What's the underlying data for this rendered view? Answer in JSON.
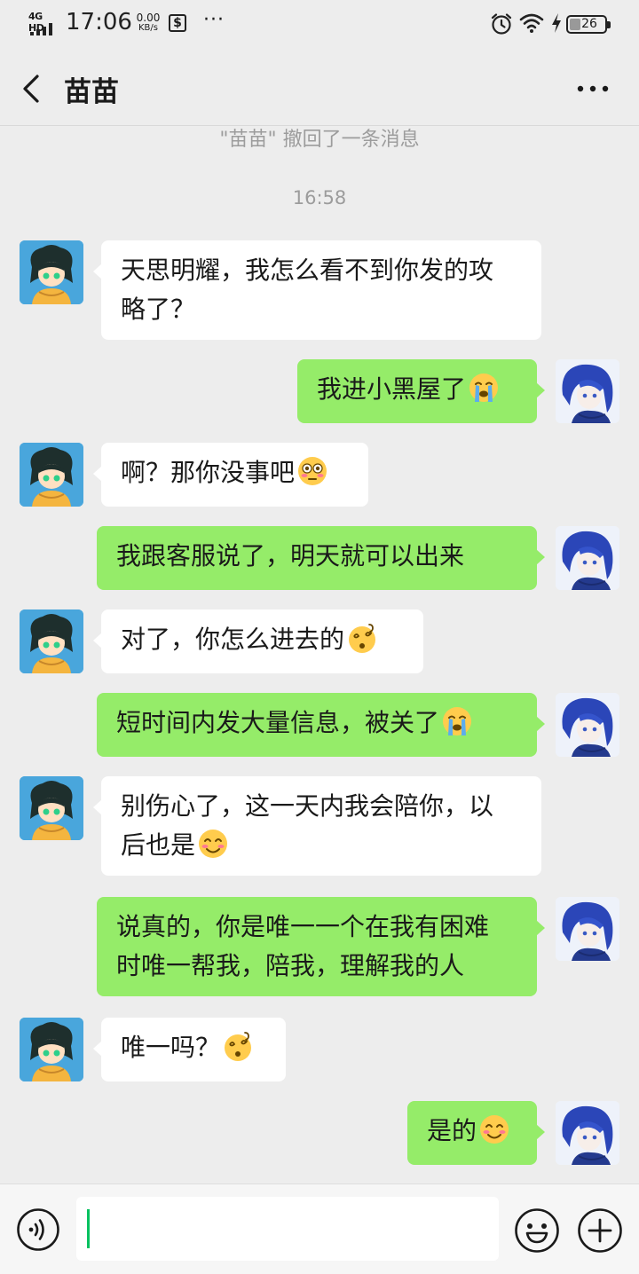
{
  "status_bar": {
    "network": "4G HD",
    "time": "17:06",
    "speed_value": "0.00",
    "speed_unit": "KB/s",
    "dollar_icon": "$",
    "more": "···",
    "battery": "26"
  },
  "header": {
    "title": "苗苗",
    "back_icon": "chevron-left-icon",
    "more_icon": "more-dots-icon"
  },
  "conversation": {
    "recall_notice": "\"苗苗\" 撤回了一条消息",
    "timestamp": "16:58",
    "messages": [
      {
        "side": "left",
        "text": "天思明耀，我怎么看不到你发的攻\n略了？",
        "emoji": ""
      },
      {
        "side": "right",
        "text": "我进小黑屋了",
        "emoji": "crying-face"
      },
      {
        "side": "left",
        "text": "啊？那你没事吧",
        "emoji": "flushed-face"
      },
      {
        "side": "right",
        "text": "我跟客服说了，明天就可以出来",
        "emoji": ""
      },
      {
        "side": "left",
        "text": "对了，你怎么进去的",
        "emoji": "dizzy-face"
      },
      {
        "side": "right",
        "text": "短时间内发大量信息，被关了",
        "emoji": "crying-face"
      },
      {
        "side": "left",
        "text": "别伤心了，这一天内我会陪你，以\n后也是",
        "emoji": "smiling-face"
      },
      {
        "side": "right",
        "text": "说真的，你是唯一一个在我有困难\n时唯一帮我，陪我，理解我的人",
        "emoji": ""
      },
      {
        "side": "left",
        "text": "唯一吗？",
        "emoji": "dizzy-face"
      },
      {
        "side": "right",
        "text": "是的",
        "emoji": "smiling-face"
      }
    ]
  },
  "input_bar": {
    "voice_icon": "voice-icon",
    "input_value": "",
    "emoji_icon": "emoji-icon",
    "add_icon": "plus-icon"
  },
  "colors": {
    "background": "#ededed",
    "sent_bubble": "#95ec69",
    "received_bubble": "#ffffff",
    "caret": "#07c160"
  }
}
